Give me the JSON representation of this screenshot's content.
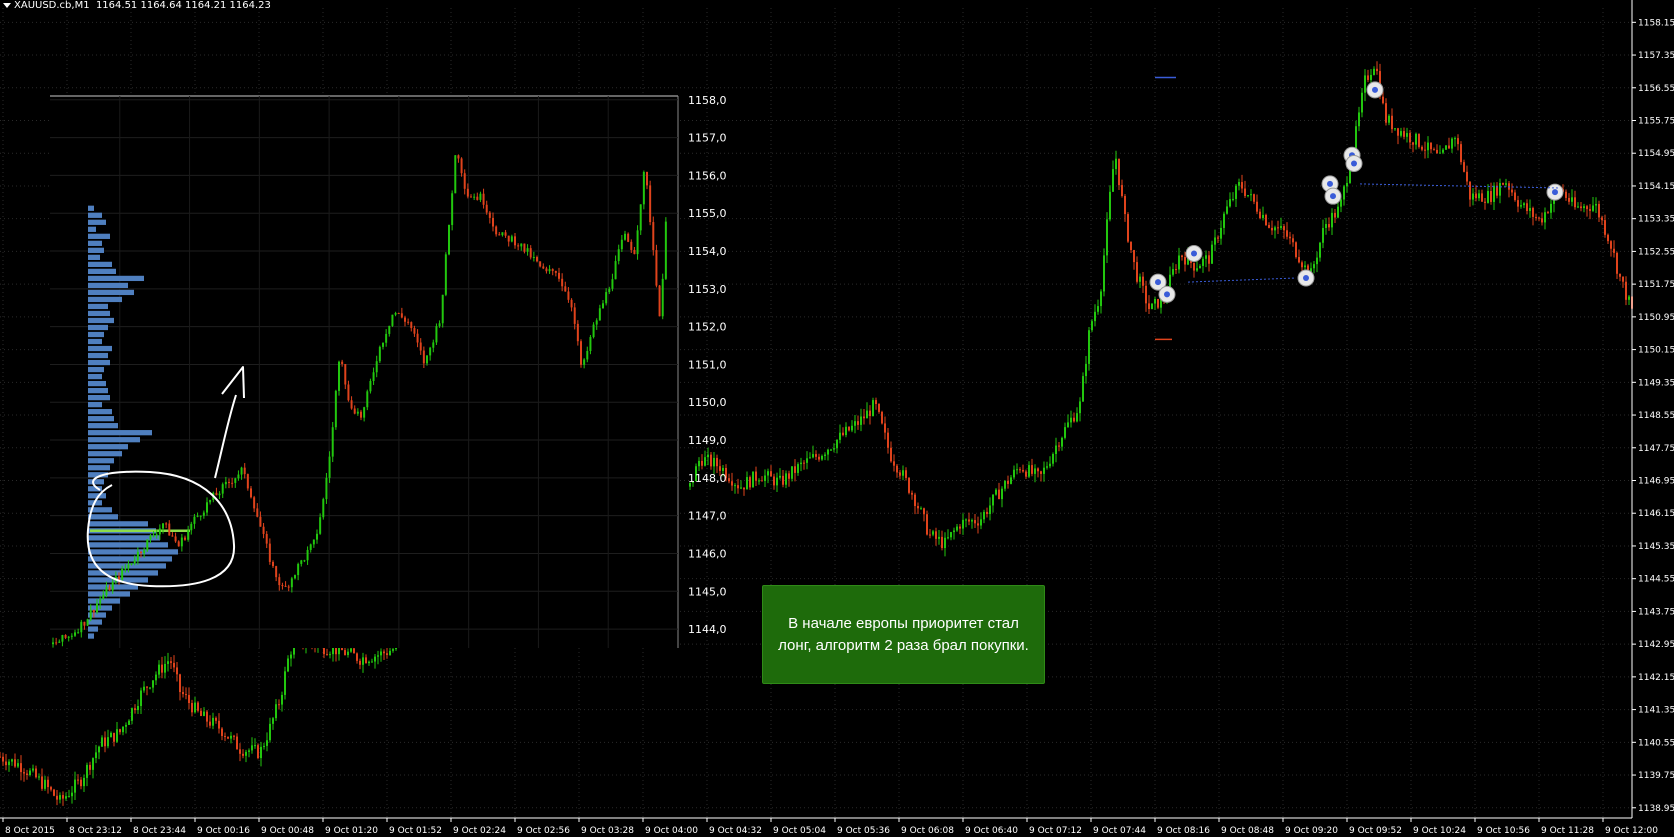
{
  "header": {
    "symbol": "XAUUSD.cb,M1",
    "ohlc": "1164.51 1164.64 1164.21 1164.23"
  },
  "callout": {
    "text": "В начале европы приоритет стал лонг, алгоритм 2 раза брал покупки."
  },
  "colors": {
    "background": "#000000",
    "bull": "#22c70e",
    "bear": "#e0431c",
    "volume": "#4f7fbf",
    "poc": "#8ddc4a",
    "callout": "#1e6b0b",
    "markers": "#3a5cd8"
  },
  "chart_data": [
    {
      "type": "line",
      "title": "",
      "series": [
        {
          "values": [
            [
              0,
              1140.2
            ],
            [
              20,
              1140.0
            ],
            [
              45,
              1139.5
            ],
            [
              60,
              1139.1
            ],
            [
              80,
              1139.6
            ],
            [
              100,
              1140.5
            ],
            [
              120,
              1140.8
            ],
            [
              140,
              1141.7
            ],
            [
              155,
              1142.2
            ],
            [
              170,
              1142.6
            ],
            [
              180,
              1141.8
            ],
            [
              200,
              1141.2
            ],
            [
              220,
              1140.9
            ],
            [
              240,
              1140.4
            ],
            [
              260,
              1140.3
            ],
            [
              270,
              1140.9
            ],
            [
              280,
              1141.6
            ],
            [
              290,
              1142.8
            ],
            [
              300,
              1143.0
            ],
            [
              320,
              1142.9
            ],
            [
              340,
              1142.8
            ],
            [
              360,
              1142.6
            ],
            [
              380,
              1142.7
            ],
            [
              400,
              1142.9
            ],
            [
              690,
              1146.8
            ],
            [
              700,
              1147.5
            ],
            [
              720,
              1147.3
            ],
            [
              740,
              1146.8
            ],
            [
              760,
              1147.1
            ],
            [
              780,
              1146.9
            ],
            [
              800,
              1147.3
            ],
            [
              820,
              1147.6
            ],
            [
              840,
              1148.0
            ],
            [
              860,
              1148.4
            ],
            [
              875,
              1148.8
            ],
            [
              890,
              1147.6
            ],
            [
              900,
              1147.2
            ],
            [
              915,
              1146.5
            ],
            [
              930,
              1145.6
            ],
            [
              945,
              1145.4
            ],
            [
              960,
              1145.9
            ],
            [
              980,
              1146.0
            ],
            [
              1000,
              1146.7
            ],
            [
              1020,
              1147.3
            ],
            [
              1040,
              1147.0
            ],
            [
              1060,
              1148.0
            ],
            [
              1080,
              1148.8
            ],
            [
              1090,
              1150.7
            ],
            [
              1100,
              1151.5
            ],
            [
              1110,
              1153.9
            ],
            [
              1115,
              1155.0
            ],
            [
              1125,
              1153.3
            ],
            [
              1135,
              1152.1
            ],
            [
              1150,
              1151.1
            ],
            [
              1165,
              1151.5
            ],
            [
              1180,
              1152.5
            ],
            [
              1195,
              1152.2
            ],
            [
              1210,
              1152.4
            ],
            [
              1225,
              1153.5
            ],
            [
              1240,
              1154.2
            ],
            [
              1255,
              1153.7
            ],
            [
              1270,
              1153.2
            ],
            [
              1285,
              1153.0
            ],
            [
              1300,
              1152.4
            ],
            [
              1310,
              1151.9
            ],
            [
              1325,
              1153.2
            ],
            [
              1340,
              1153.6
            ],
            [
              1355,
              1155.3
            ],
            [
              1365,
              1156.7
            ],
            [
              1375,
              1157.2
            ],
            [
              1385,
              1155.8
            ],
            [
              1400,
              1155.5
            ],
            [
              1420,
              1155.2
            ],
            [
              1440,
              1154.8
            ],
            [
              1455,
              1155.4
            ],
            [
              1470,
              1153.9
            ],
            [
              1490,
              1153.9
            ],
            [
              1505,
              1154.3
            ],
            [
              1520,
              1153.7
            ],
            [
              1540,
              1153.3
            ],
            [
              1560,
              1154.1
            ],
            [
              1575,
              1153.6
            ],
            [
              1595,
              1153.7
            ],
            [
              1610,
              1152.8
            ],
            [
              1620,
              1151.9
            ],
            [
              1632,
              1151.1
            ]
          ]
        }
      ],
      "y_ticks": [
        "1158.15",
        "1157.35",
        "1156.55",
        "1155.75",
        "1154.95",
        "1154.15",
        "1153.35",
        "1152.55",
        "1151.75",
        "1150.95",
        "1150.15",
        "1149.35",
        "1148.55",
        "1147.75",
        "1146.95",
        "1146.15",
        "1145.35",
        "1144.55",
        "1143.75",
        "1142.95",
        "1142.15",
        "1141.35",
        "1140.55",
        "1139.75",
        "1138.95"
      ],
      "x_ticks": [
        "8 Oct 2015",
        "8 Oct 23:12",
        "8 Oct 23:44",
        "9 Oct 00:16",
        "9 Oct 00:48",
        "9 Oct 01:20",
        "9 Oct 01:52",
        "9 Oct 02:24",
        "9 Oct 02:56",
        "9 Oct 03:28",
        "9 Oct 04:00",
        "9 Oct 04:32",
        "9 Oct 05:04",
        "9 Oct 05:36",
        "9 Oct 06:08",
        "9 Oct 06:40",
        "9 Oct 07:12",
        "9 Oct 07:44",
        "9 Oct 08:16",
        "9 Oct 08:48",
        "9 Oct 09:20",
        "9 Oct 09:52",
        "9 Oct 10:24",
        "9 Oct 10:56",
        "9 Oct 11:28",
        "9 Oct 12:00"
      ],
      "ylim": [
        1138.7,
        1158.5
      ],
      "grid": true,
      "legend": "none"
    },
    {
      "type": "line",
      "title": "",
      "series": [
        {
          "values": [
            [
              0,
              1143.6
            ],
            [
              15,
              1143.8
            ],
            [
              30,
              1144.2
            ],
            [
              45,
              1144.8
            ],
            [
              60,
              1145.3
            ],
            [
              75,
              1145.8
            ],
            [
              90,
              1146.3
            ],
            [
              105,
              1146.8
            ],
            [
              120,
              1146.2
            ],
            [
              135,
              1146.9
            ],
            [
              150,
              1147.4
            ],
            [
              165,
              1147.8
            ],
            [
              180,
              1148.2
            ],
            [
              190,
              1147.5
            ],
            [
              200,
              1146.5
            ],
            [
              210,
              1145.6
            ],
            [
              220,
              1145.0
            ],
            [
              235,
              1145.7
            ],
            [
              250,
              1146.3
            ],
            [
              258,
              1147.4
            ],
            [
              266,
              1149.0
            ],
            [
              274,
              1151.5
            ],
            [
              282,
              1150.0
            ],
            [
              295,
              1149.6
            ],
            [
              310,
              1151.3
            ],
            [
              325,
              1152.4
            ],
            [
              340,
              1152.1
            ],
            [
              355,
              1151.0
            ],
            [
              370,
              1152.3
            ],
            [
              385,
              1156.8
            ],
            [
              395,
              1155.5
            ],
            [
              410,
              1155.4
            ],
            [
              425,
              1154.4
            ],
            [
              440,
              1154.3
            ],
            [
              455,
              1153.9
            ],
            [
              470,
              1153.4
            ],
            [
              480,
              1153.5
            ],
            [
              495,
              1152.6
            ],
            [
              505,
              1150.8
            ],
            [
              515,
              1151.9
            ],
            [
              530,
              1153.0
            ],
            [
              545,
              1154.4
            ],
            [
              555,
              1154.0
            ],
            [
              565,
              1156.2
            ],
            [
              575,
              1153.5
            ],
            [
              580,
              1152.0
            ],
            [
              585,
              1154.9
            ]
          ]
        }
      ],
      "volume_profile": [
        6,
        14,
        18,
        8,
        22,
        14,
        16,
        12,
        24,
        28,
        56,
        40,
        46,
        34,
        20,
        22,
        26,
        20,
        16,
        14,
        24,
        20,
        22,
        16,
        14,
        18,
        20,
        22,
        14,
        24,
        26,
        30,
        64,
        52,
        40,
        34,
        26,
        22,
        20,
        16,
        14,
        18,
        14,
        24,
        30,
        60,
        68,
        72,
        80,
        90,
        84,
        78,
        70,
        60,
        50,
        42,
        32,
        24,
        18,
        14,
        10,
        6
      ],
      "poc": 1146.6,
      "y_ticks": [
        "1158,0",
        "1157,0",
        "1156,0",
        "1155,0",
        "1154,0",
        "1153,0",
        "1152,0",
        "1151,0",
        "1150,0",
        "1149,0",
        "1148,0",
        "1147,0",
        "1146,0",
        "1145,0",
        "1144,0"
      ],
      "ylim": [
        1143.5,
        1158.1
      ],
      "grid": true,
      "legend": "none"
    }
  ]
}
